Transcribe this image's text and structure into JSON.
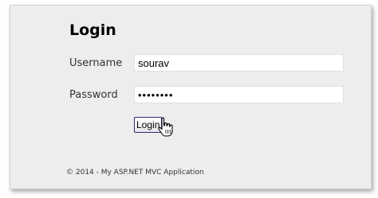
{
  "page": {
    "heading": "Login"
  },
  "form": {
    "username_label": "Username",
    "username_value": "sourav",
    "password_label": "Password",
    "password_value": "12345678",
    "login_label": "Login"
  },
  "footer": {
    "text": "© 2014 - My ASP.NET MVC Application"
  },
  "cursor": {
    "icon": "hand-pointer-icon"
  }
}
